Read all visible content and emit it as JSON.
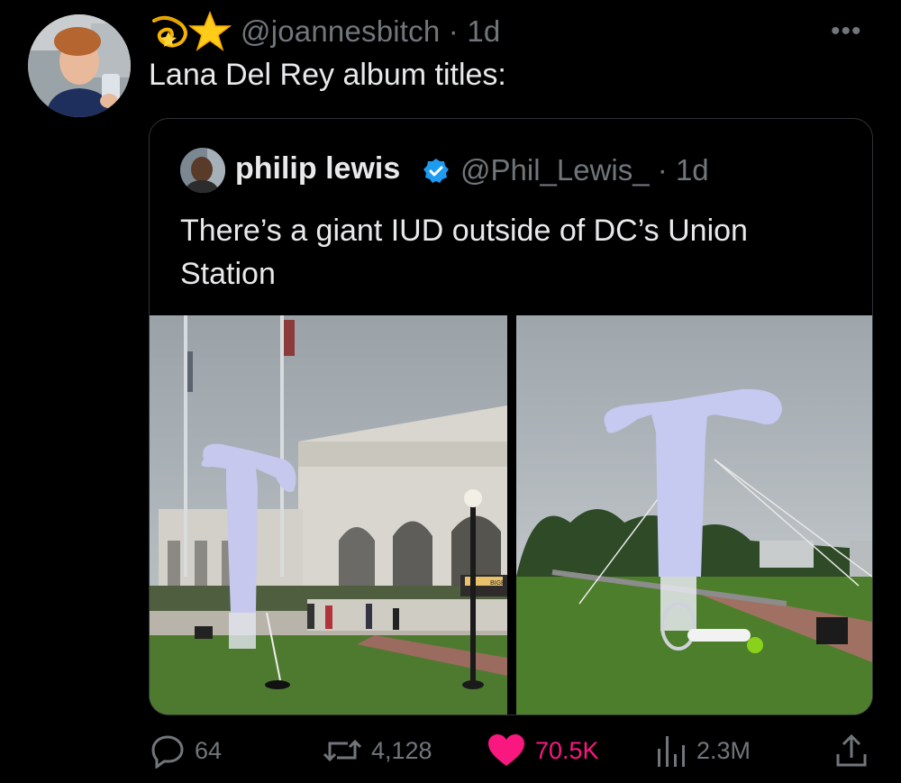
{
  "tweet": {
    "handle": "@joannesbitch",
    "time": "1d",
    "text": "Lana Del Rey album titles:",
    "emoji": [
      "dizzy-emoji",
      "star-emoji"
    ],
    "more_icon": "more-icon"
  },
  "quote": {
    "name": "philip lewis",
    "verified": true,
    "handle": "@Phil_Lewis_",
    "time": "1d",
    "text": "There’s a giant IUD outside of DC’s Union Station",
    "photo_sign": "BIGB"
  },
  "actions": {
    "replies": "64",
    "retweets": "4,128",
    "likes": "70.5K",
    "views": "2.3M",
    "liked": true
  },
  "colors": {
    "background": "#000000",
    "muted": "#71767b",
    "like": "#f91880",
    "verified": "#1d9bf0"
  }
}
